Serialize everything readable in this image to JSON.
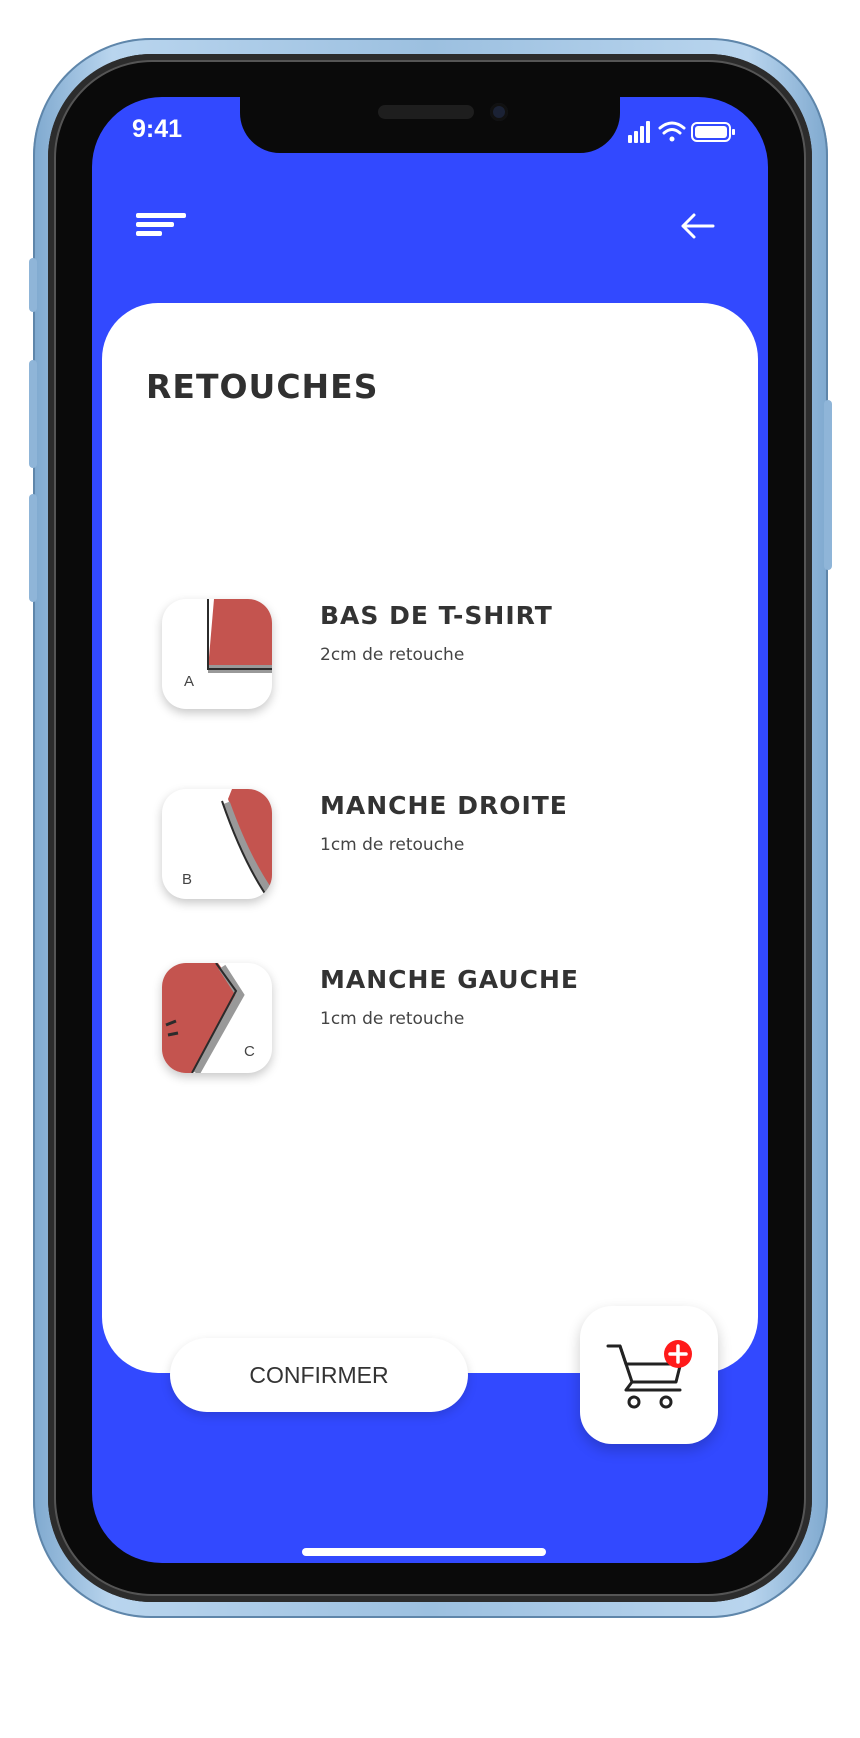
{
  "status_bar": {
    "time": "9:41"
  },
  "header": {
    "menu_icon": "menu-icon",
    "back_icon": "arrow-left-icon"
  },
  "page": {
    "title": "RETOUCHES"
  },
  "items": [
    {
      "label": "A",
      "name": "BAS DE T-SHIRT",
      "detail": "2cm de retouche"
    },
    {
      "label": "B",
      "name": "MANCHE DROITE",
      "detail": "1cm de retouche"
    },
    {
      "label": "C",
      "name": "MANCHE GAUCHE",
      "detail": "1cm de retouche"
    }
  ],
  "actions": {
    "confirm_label": "CONFIRMER",
    "cart_icon": "cart-add-icon"
  },
  "colors": {
    "primary": "#3249ff",
    "fabric": "#c4544f",
    "badge": "#ff1a1a"
  }
}
